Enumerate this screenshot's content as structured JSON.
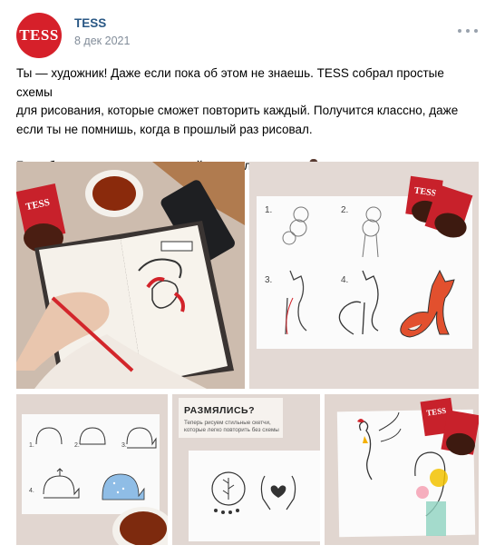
{
  "post": {
    "author": "TESS",
    "avatar_text": "TESS",
    "date": "8 дек 2021",
    "text_lines": [
      "Ты — художник! Даже если пока об этом не знаешь. TESS собрал простые схемы",
      "для рисования, которые сможет повторить каждый. Получится классно, даже",
      "если ты не помнишь, когда в прошлый раз рисовал."
    ],
    "text_line2": "Бери бумагу и карандаш, листай карусель и твори 👨‍🎨"
  },
  "gallery": {
    "tile2": {
      "step_labels": [
        "1.",
        "2.",
        "3.",
        "4."
      ],
      "pack_brand": "TESS"
    },
    "tile3": {
      "step_labels": [
        "1.",
        "2.",
        "3.",
        "4."
      ]
    },
    "tile4": {
      "title": "РАЗМЯЛИСЬ?",
      "subtitle": "Теперь рисуем стильные скетчи, которые легко повторить без схемы"
    },
    "tile5": {
      "pack_brand": "TESS"
    },
    "tile1": {
      "pack_brand": "TESS"
    }
  },
  "colors": {
    "brand_red": "#d6202a",
    "link_blue": "#2a5885",
    "meta_gray": "#818c99"
  }
}
